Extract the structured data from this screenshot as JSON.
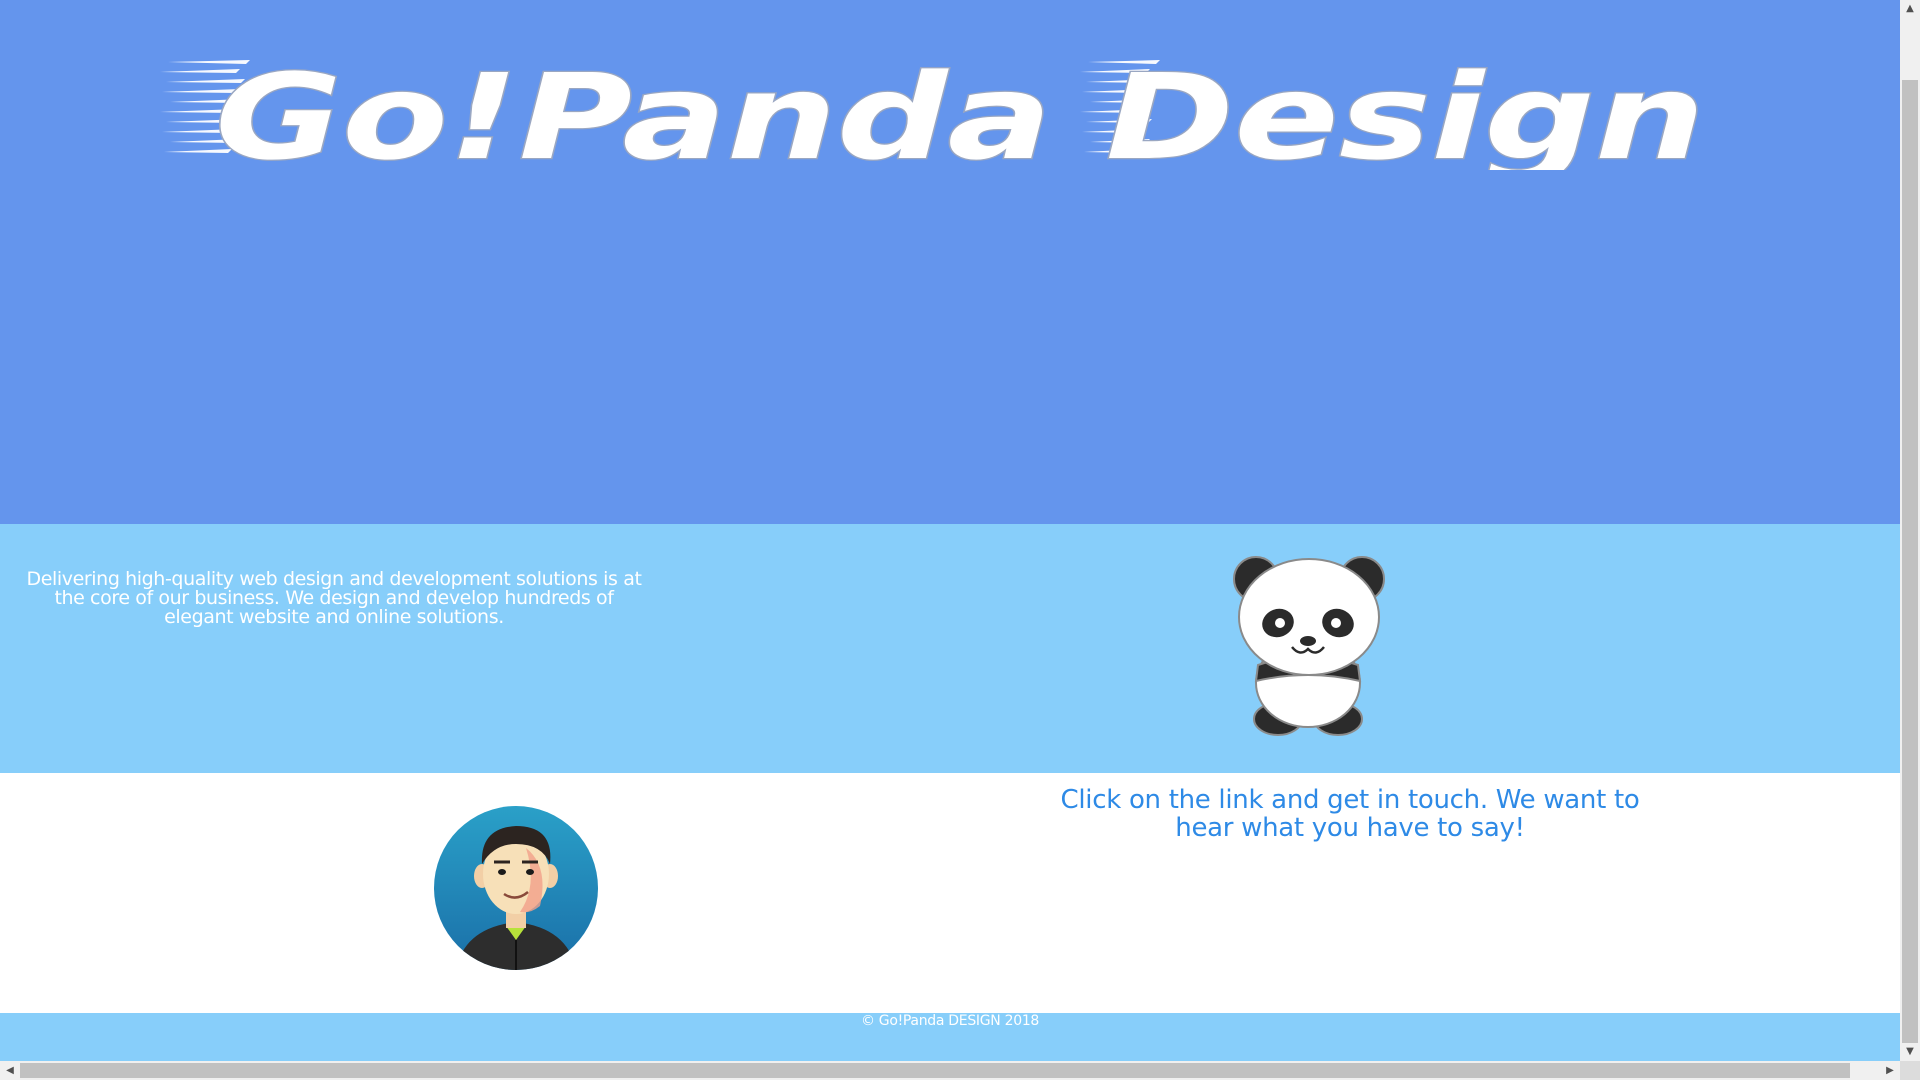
{
  "header": {
    "logo_text": "Go!Panda Design",
    "colors": {
      "background": "#6495ED",
      "logo_fill": "#ffffff",
      "speed_lines": "#ffffff"
    }
  },
  "intro": {
    "text": "Delivering high-quality web design and development solutions is at the core of our business. We design and develop hundreds of elegant website and online solutions.",
    "illustration": "panda-mascot",
    "colors": {
      "background": "#87CEFA",
      "text": "#ffffff"
    }
  },
  "contact": {
    "avatar": "developer-avatar",
    "link_text": "Click on the link and get in touch. We want to hear what you have to say!",
    "colors": {
      "background": "#ffffff",
      "link": "#2E8AE6"
    }
  },
  "footer": {
    "text": "© Go!Panda DESIGN 2018",
    "colors": {
      "background": "#87CEFA",
      "text": "#ffffff"
    }
  },
  "scrollbars": {
    "vertical": {
      "up_icon": "chevron-up-icon",
      "down_icon": "chevron-down-icon"
    },
    "horizontal": {
      "left_icon": "chevron-left-icon",
      "right_icon": "chevron-right-icon"
    }
  }
}
